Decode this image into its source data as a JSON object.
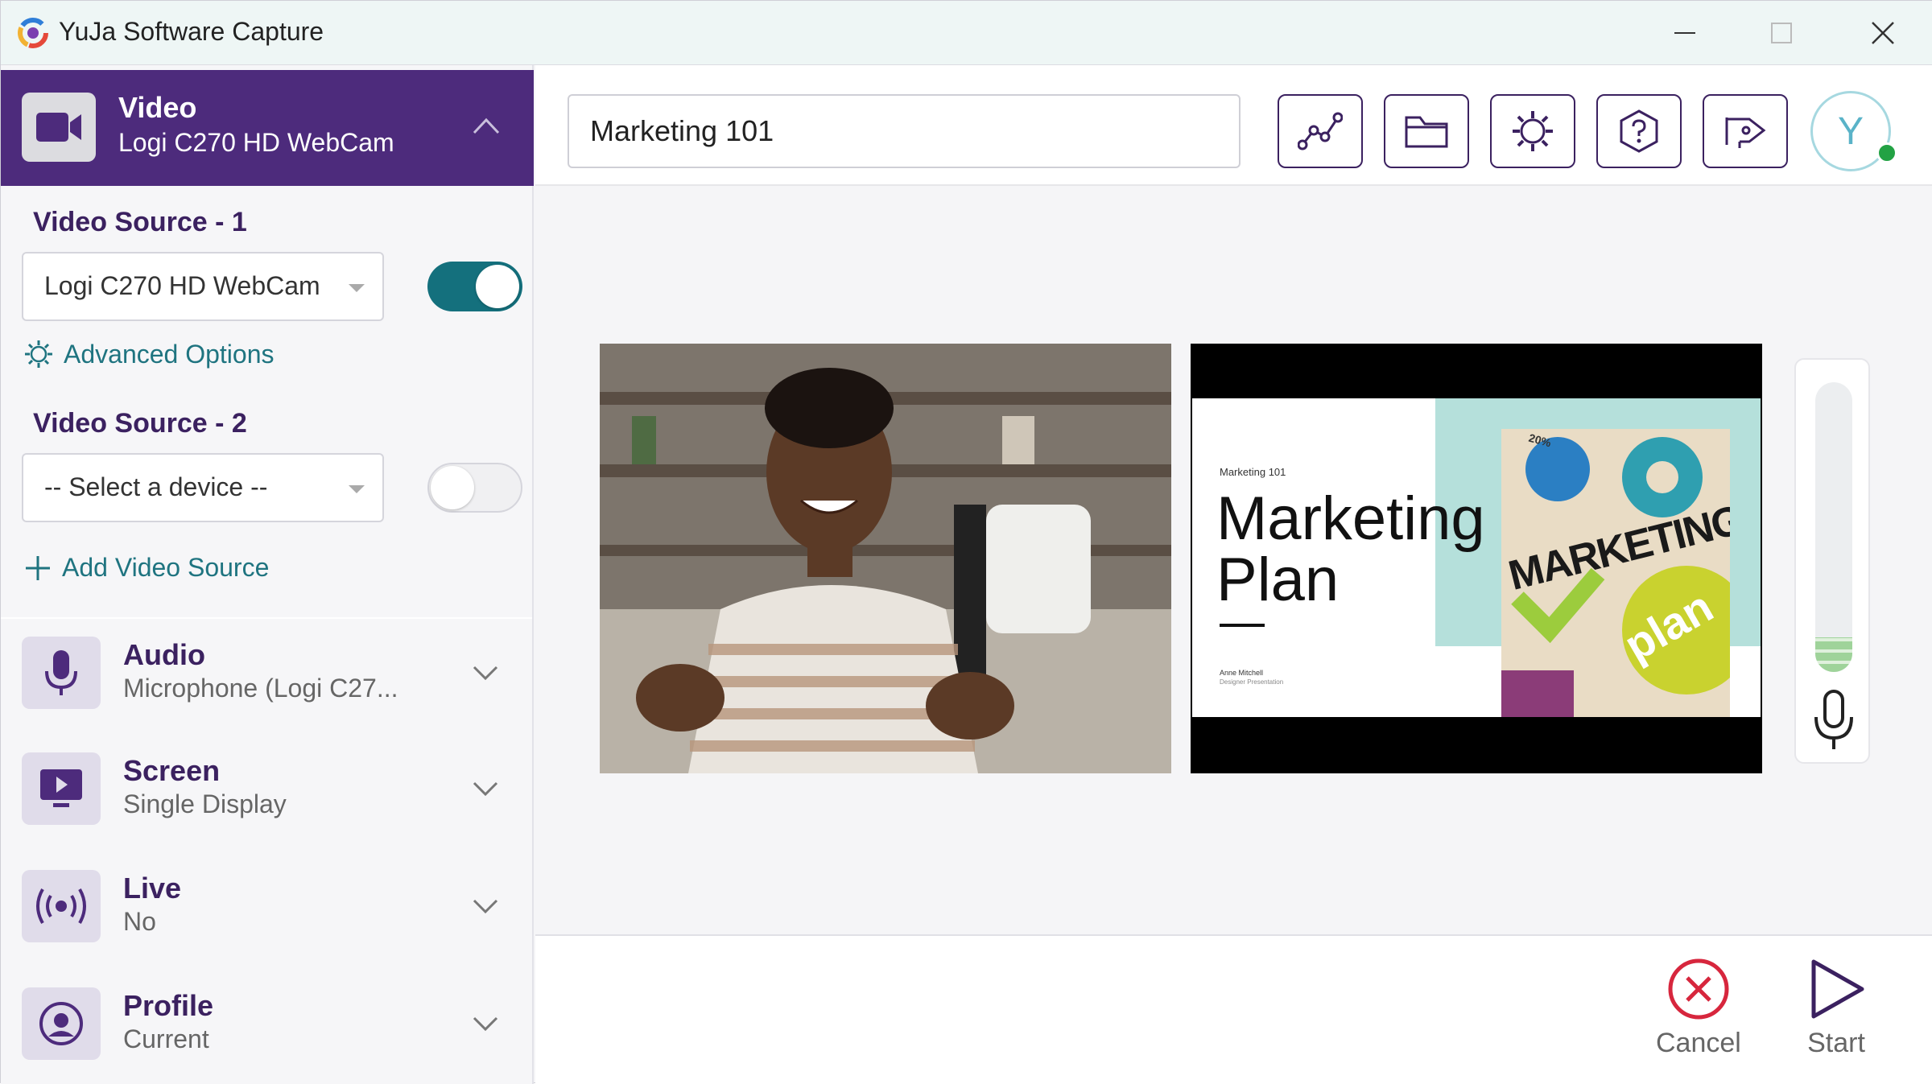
{
  "window": {
    "title": "YuJa Software Capture"
  },
  "sidebar": {
    "video": {
      "title": "Video",
      "subtitle": "Logi C270 HD WebCam"
    },
    "source1": {
      "label": "Video Source - 1",
      "selected": "Logi C270 HD WebCam",
      "enabled": true
    },
    "advanced_options": "Advanced Options",
    "source2": {
      "label": "Video Source - 2",
      "selected": "-- Select a device --",
      "enabled": false
    },
    "add_source": "Add Video Source",
    "sections": [
      {
        "title": "Audio",
        "subtitle": "Microphone (Logi C27..."
      },
      {
        "title": "Screen",
        "subtitle": "Single Display"
      },
      {
        "title": "Live",
        "subtitle": "No"
      },
      {
        "title": "Profile",
        "subtitle": "Current"
      }
    ]
  },
  "toolbar": {
    "title_value": "Marketing 101",
    "avatar_initial": "Y"
  },
  "slide": {
    "kicker": "Marketing 101",
    "title_line1": "Marketing",
    "title_line2": "Plan",
    "author": "Anne Mitchell",
    "author_role": "Designer Presentation",
    "image_word1": "MARKETING",
    "image_word2": "plan",
    "image_badge": "20%"
  },
  "audio_meter": {
    "level": 0.12
  },
  "footer": {
    "cancel_label": "Cancel",
    "start_label": "Start"
  },
  "colors": {
    "brand_purple": "#4d2b7c",
    "teal": "#1f7480",
    "toggle_on": "#14707d",
    "cancel_red": "#d7263d"
  }
}
